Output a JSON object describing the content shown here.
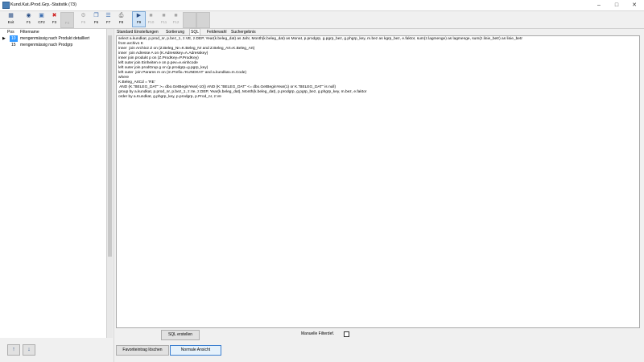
{
  "window": {
    "title": "Kund.Kat./Prod.Grp.-Statistik (73)",
    "controls": [
      "minimize-icon",
      "maximize-icon",
      "close-icon"
    ]
  },
  "toolbar": {
    "buttons": [
      {
        "label": "Exit",
        "icon": "exit-icon",
        "enabled": true
      },
      {
        "label": "F1",
        "icon": "help-icon",
        "enabled": true
      },
      {
        "label": "CF2",
        "icon": "new-icon",
        "enabled": true
      },
      {
        "label": "F3",
        "icon": "delete-icon",
        "enabled": true
      },
      {
        "label": "F4",
        "icon": "blank-icon",
        "enabled": false
      },
      {
        "label": "F5",
        "icon": "tools-icon",
        "enabled": false
      },
      {
        "label": "F6",
        "icon": "copy-icon",
        "enabled": true
      },
      {
        "label": "F7",
        "icon": "list-icon",
        "enabled": true
      },
      {
        "label": "F8",
        "icon": "print-icon",
        "enabled": true
      },
      {
        "label": "F9",
        "icon": "run-icon",
        "enabled": true
      },
      {
        "label": "F10",
        "icon": "disabled-icon",
        "enabled": false
      },
      {
        "label": "F11",
        "icon": "disabled-icon",
        "enabled": false
      },
      {
        "label": "F12",
        "icon": "filter-icon",
        "enabled": false
      }
    ]
  },
  "list": {
    "headers": {
      "pos": "Pos",
      "name": "Filtername"
    },
    "rows": [
      {
        "pos": "10",
        "name": "mengenmässig nach Produkt detailliert",
        "selected": true
      },
      {
        "pos": "15",
        "name": "mengenmässig nach Prodgrp",
        "selected": false
      }
    ],
    "row_marker": "▶"
  },
  "nav": {
    "up": "↑",
    "down": "↓"
  },
  "tabs": {
    "items": [
      "Standard Einstellungen",
      "Sortierung",
      "SQL",
      "Felderwahl",
      "Suchergebnis"
    ],
    "active": "SQL"
  },
  "sql": {
    "lines": [
      "select a.kundkat, p.prod_nr, p.bez_1, z.VE, z.DEP, Year(k.beleg_dat) as Jahr, Month(k.beleg_dat) as Monat, p.prodgrp, g.pgrp_bez, g.phgrp_key, m.bez as kgrp_bez, e.faktor, sum(z.lagmenge) as lagmenge, sum(z.linie_betr) as linie_betr",
      "from archiv1 K",
      "inner  join Archiv2 Z on (Z.Beleg_Nr=K.Beleg_Nr and Z.Beleg_Art=K.Beleg_Art)",
      "inner  join Adresse A on (K.Adresskey=A.Adresskey)",
      "inner join produkt p on (Z.ProdKey=P.ProdKey)",
      "left outer join Einheiten e on p.pev=e.einhcode",
      "left outer join prodGrup g on (p.prodgrp=g.pgrp_key)",
      "left outer  join Params m on (m.Prefix='KUNDKAT' and a.kundkat=m.Code)",
      "where",
      "K.Beleg_ArtCd = 'RE'",
      " AND (K.\"BELEG_DAT\" >= dbo.GetBeginYear(-10)) AND (K.\"BELEG_DAT\" <= dbo.GetBeginYear(1) or K.\"BELEG_DAT\" is null)",
      "group by a.kundkat, p.prod_nr, p.bez_1, z.Ve, z.DEP, Year(k.beleg_dat), Month(k.beleg_dat), p.prodgrp, g.pgrp_bez, g.phgrp_key, m.bez, e.faktor",
      "order by a.Kundkat, g.phgrp_key, p.prodgrp, p.Prod_nr, z.Ve"
    ]
  },
  "bottom": {
    "sql_button": "SQL erstellen",
    "manual_filter_label": "Manuelle Filterdef.",
    "manual_filter_checked": false,
    "delete_favorite_button": "Favoriteintrag löschen",
    "normal_view_button": "Normale Ansicht"
  }
}
